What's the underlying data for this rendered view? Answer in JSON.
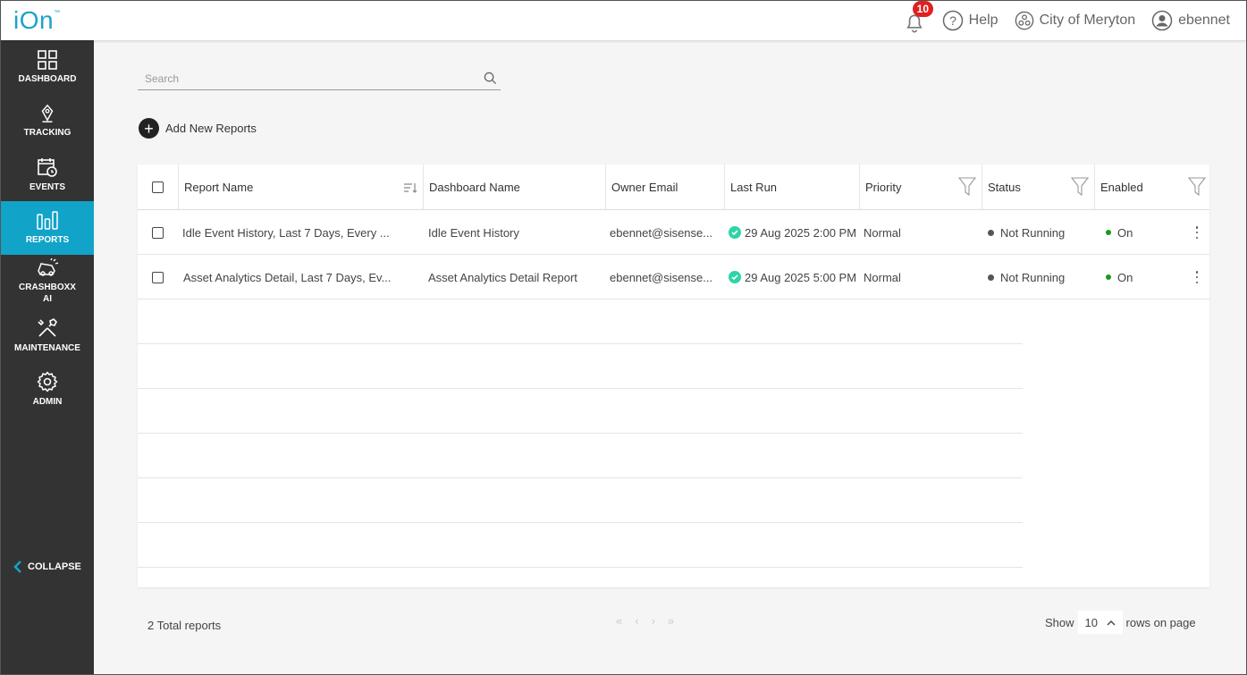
{
  "header": {
    "logo": "iOn",
    "logo_tm": "™",
    "notifications_count": "10",
    "help_label": "Help",
    "org_label": "City of Meryton",
    "user_label": "ebennet"
  },
  "sidebar": {
    "items": [
      {
        "label": "DASHBOARD",
        "icon": "dashboard-icon"
      },
      {
        "label": "TRACKING",
        "icon": "map-pin-icon"
      },
      {
        "label": "EVENTS",
        "icon": "calendar-clock-icon"
      },
      {
        "label": "REPORTS",
        "icon": "bar-chart-icon"
      },
      {
        "label": "CRASHBOXX",
        "label2": "AI",
        "icon": "crash-car-icon"
      },
      {
        "label": "MAINTENANCE",
        "icon": "tools-icon"
      },
      {
        "label": "ADMIN",
        "icon": "gear-icon"
      }
    ],
    "collapse_label": "COLLAPSE"
  },
  "search": {
    "placeholder": "Search"
  },
  "add_button": {
    "label": "Add New Reports"
  },
  "table": {
    "columns": [
      "Report Name",
      "Dashboard Name",
      "Owner Email",
      "Last Run",
      "Priority",
      "Status",
      "Enabled"
    ],
    "rows": [
      {
        "report_name": "Idle Event History, Last 7 Days, Every ...",
        "dashboard_name": "Idle Event History",
        "owner_email": "ebennet@sisense...",
        "last_run": "29 Aug 2025 2:00 PM",
        "priority": "Normal",
        "status": "Not Running",
        "enabled": "On"
      },
      {
        "report_name": "Asset Analytics Detail, Last 7 Days, Ev...",
        "dashboard_name": "Asset Analytics Detail Report",
        "owner_email": "ebennet@sisense...",
        "last_run": "29 Aug 2025 5:00 PM",
        "priority": "Normal",
        "status": "Not Running",
        "enabled": "On"
      }
    ]
  },
  "footer": {
    "total": "2 Total reports",
    "show_label": "Show",
    "rows_value": "10",
    "rows_suffix": "rows on page"
  },
  "colors": {
    "accent": "#12a3c9",
    "sidebar_bg": "#333333",
    "badge": "#e02020",
    "success": "#2dd4a8",
    "enabled_dot": "#1a9a1a",
    "status_dot": "#555555"
  }
}
